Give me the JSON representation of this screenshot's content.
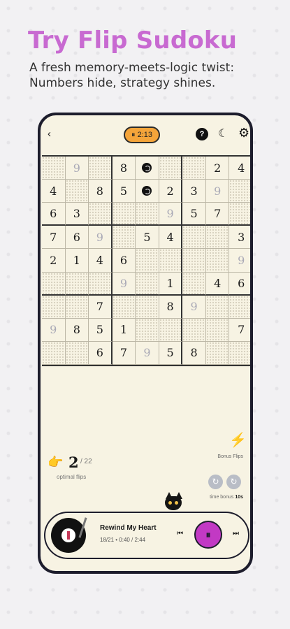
{
  "promo": {
    "headline": "Try Flip Sudoku",
    "subline": "A fresh memory-meets-logic twist: Numbers hide, strategy shines."
  },
  "topbar": {
    "back_icon": "chevron-left-icon",
    "timer": "⏸ 2:13",
    "help_icon": "?",
    "moon_icon": "☾",
    "settings_icon": "⚙"
  },
  "board": {
    "rows": [
      [
        {
          "v": "",
          "s": "dots"
        },
        {
          "v": "9",
          "s": "faint"
        },
        {
          "v": "",
          "s": "dots"
        },
        {
          "v": "8",
          "s": "given"
        },
        {
          "v": "swirl",
          "s": "swirl"
        },
        {
          "v": "",
          "s": "dots"
        },
        {
          "v": "",
          "s": "dots"
        },
        {
          "v": "2",
          "s": "given"
        },
        {
          "v": "4",
          "s": "given"
        }
      ],
      [
        {
          "v": "4",
          "s": "given"
        },
        {
          "v": "",
          "s": "dots"
        },
        {
          "v": "8",
          "s": "given"
        },
        {
          "v": "5",
          "s": "given"
        },
        {
          "v": "swirl",
          "s": "swirl"
        },
        {
          "v": "2",
          "s": "given"
        },
        {
          "v": "3",
          "s": "given"
        },
        {
          "v": "9",
          "s": "faint"
        },
        {
          "v": "",
          "s": "dots"
        }
      ],
      [
        {
          "v": "6",
          "s": "given"
        },
        {
          "v": "3",
          "s": "given"
        },
        {
          "v": "",
          "s": "dots"
        },
        {
          "v": "",
          "s": "dots"
        },
        {
          "v": "",
          "s": "dots"
        },
        {
          "v": "9",
          "s": "faint"
        },
        {
          "v": "5",
          "s": "given"
        },
        {
          "v": "7",
          "s": "given"
        },
        {
          "v": "",
          "s": "dots"
        }
      ],
      [
        {
          "v": "7",
          "s": "given"
        },
        {
          "v": "6",
          "s": "given"
        },
        {
          "v": "9",
          "s": "faint"
        },
        {
          "v": "",
          "s": "dots"
        },
        {
          "v": "5",
          "s": "given"
        },
        {
          "v": "4",
          "s": "given"
        },
        {
          "v": "",
          "s": "dots"
        },
        {
          "v": "",
          "s": "dots"
        },
        {
          "v": "3",
          "s": "given"
        }
      ],
      [
        {
          "v": "2",
          "s": "given"
        },
        {
          "v": "1",
          "s": "given"
        },
        {
          "v": "4",
          "s": "given"
        },
        {
          "v": "6",
          "s": "given"
        },
        {
          "v": "",
          "s": "dots"
        },
        {
          "v": "",
          "s": "dots"
        },
        {
          "v": "",
          "s": "dots"
        },
        {
          "v": "",
          "s": "dots"
        },
        {
          "v": "9",
          "s": "faint"
        }
      ],
      [
        {
          "v": "",
          "s": "dots"
        },
        {
          "v": "",
          "s": "dots"
        },
        {
          "v": "",
          "s": "dots"
        },
        {
          "v": "9",
          "s": "faint"
        },
        {
          "v": "",
          "s": "dots"
        },
        {
          "v": "1",
          "s": "given"
        },
        {
          "v": "",
          "s": "dots"
        },
        {
          "v": "4",
          "s": "given"
        },
        {
          "v": "6",
          "s": "given"
        }
      ],
      [
        {
          "v": "",
          "s": "dots"
        },
        {
          "v": "",
          "s": "dots"
        },
        {
          "v": "7",
          "s": "given"
        },
        {
          "v": "",
          "s": "dots"
        },
        {
          "v": "",
          "s": "dots"
        },
        {
          "v": "8",
          "s": "given"
        },
        {
          "v": "9",
          "s": "faint"
        },
        {
          "v": "",
          "s": "dots"
        },
        {
          "v": "",
          "s": "dots"
        }
      ],
      [
        {
          "v": "9",
          "s": "faint"
        },
        {
          "v": "8",
          "s": "given"
        },
        {
          "v": "5",
          "s": "given"
        },
        {
          "v": "1",
          "s": "given"
        },
        {
          "v": "",
          "s": "dots"
        },
        {
          "v": "",
          "s": "dots"
        },
        {
          "v": "",
          "s": "dots"
        },
        {
          "v": "",
          "s": "dots"
        },
        {
          "v": "7",
          "s": "given"
        }
      ],
      [
        {
          "v": "",
          "s": "dots"
        },
        {
          "v": "",
          "s": "dots"
        },
        {
          "v": "6",
          "s": "given"
        },
        {
          "v": "7",
          "s": "given"
        },
        {
          "v": "9",
          "s": "faint"
        },
        {
          "v": "5",
          "s": "given"
        },
        {
          "v": "8",
          "s": "given"
        },
        {
          "v": "",
          "s": "dots"
        },
        {
          "v": "",
          "s": "dots"
        }
      ]
    ]
  },
  "stats": {
    "flips_count": "2",
    "flips_total": "/ 22",
    "optimal_label": "optimal flips",
    "bonus_flips_label": "Bonus Flips",
    "time_bonus_label": "time bonus",
    "time_bonus_value": "10s",
    "accent_color": "#f4a43a"
  },
  "player": {
    "title": "Rewind My Heart",
    "meta": "18/21 • 0:40 / 2:44",
    "prev_icon": "⏮",
    "pause_icon": "⏸",
    "next_icon": "⏭",
    "accent_color": "#c239c4"
  }
}
